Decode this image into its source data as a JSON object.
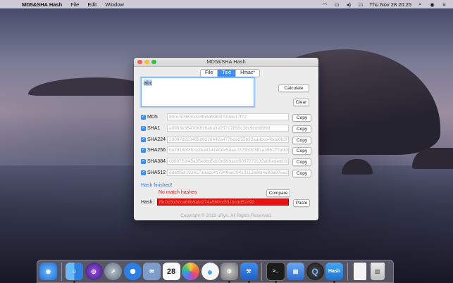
{
  "menubar": {
    "app_name": "MD5&SHA Hash",
    "menus": [
      "File",
      "Edit",
      "Window"
    ],
    "datetime": "Thu Nov 28  20:25",
    "icons": [
      "wifi-icon",
      "airplay-icon",
      "volume-icon",
      "battery-icon",
      "search-icon",
      "user-icon",
      "control-center-icon"
    ]
  },
  "window": {
    "title": "MD5&SHA Hash",
    "tabs": [
      {
        "label": "File",
        "active": false
      },
      {
        "label": "Text",
        "active": true
      },
      {
        "label": "Hmac*",
        "active": false
      }
    ],
    "input_text": "abc",
    "calculate_label": "Calculate",
    "clear_label": "Clear",
    "rows": [
      {
        "alg": "MD5",
        "hash": "900150983cd24fb0d6963f7d28e17f72",
        "copy": "Copy"
      },
      {
        "alg": "SHA1",
        "hash": "a9993e364706816aba3e25717850c26c9cd0d89d",
        "copy": "Copy"
      },
      {
        "alg": "SHA224",
        "hash": "23097d223405d8228642a477bda255b32aadbce4bda0b3f7e36c9da7",
        "copy": "Copy"
      },
      {
        "alg": "SHA256",
        "hash": "ba7816bf8f01cfea414140de5dae2223b00361a396177a9cb410ff61f20015ad",
        "copy": "Copy"
      },
      {
        "alg": "SHA384",
        "hash": "cb00753f45a35e8bb5a03d699ac65007272c32ab0eded1631a8b605a43ff5bed",
        "copy": "Copy"
      },
      {
        "alg": "SHA512",
        "hash": "ddaf35a193617abacc417349ae20413112e6fa4e89a97ea20a9eeee64b55d39a",
        "copy": "Copy"
      }
    ],
    "status": "Hash finished!",
    "match_status": "No match hashes",
    "compare_label": "Compare",
    "hash_label": "Hash:",
    "hash_value": "f8c0c5d3dca66b9afa274a560cc531bcdd52d92",
    "paste_label": "Paste",
    "copyright": "Copyright © 2018 uRyn. All Rights Reserved."
  },
  "dock": {
    "items": [
      {
        "name": "safari-icon",
        "color": "#2f8ef5",
        "glyph": "◉"
      },
      {
        "name": "finder-icon",
        "color": "#3d8ef7",
        "glyph": "☺"
      },
      {
        "name": "siri-icon",
        "color": "#3a2f7a",
        "glyph": "◎"
      },
      {
        "name": "launchpad-icon",
        "color": "#7f8a99",
        "glyph": "🚀"
      },
      {
        "name": "safari-browser-icon",
        "color": "#2d7fe8",
        "glyph": "✦"
      },
      {
        "name": "preview-icon",
        "color": "#6d8fbf",
        "glyph": "✉"
      },
      {
        "name": "calendar-icon",
        "color": "#f5f5f5",
        "glyph": "28"
      },
      {
        "name": "photos-icon",
        "color": "#f0d24a",
        "glyph": "✿"
      },
      {
        "name": "messages-icon",
        "color": "#3fa9f5",
        "glyph": "💬"
      },
      {
        "name": "system-preferences-icon",
        "color": "#8b8b8b",
        "glyph": "⚙"
      },
      {
        "name": "xcode-icon",
        "color": "#2e6fd6",
        "glyph": "⚒"
      },
      {
        "name": "terminal-icon",
        "color": "#1e1e1e",
        "glyph": ">_"
      },
      {
        "name": "keynote-icon",
        "color": "#4a8ee8",
        "glyph": "▤"
      },
      {
        "name": "quicktime-icon",
        "color": "#333",
        "glyph": "Q"
      },
      {
        "name": "hash-app-icon",
        "color": "#2c8ee6",
        "glyph": "Hash"
      },
      {
        "name": "document-icon",
        "color": "#f2f2f2",
        "glyph": ""
      },
      {
        "name": "trash-icon",
        "color": "#d9d9d9",
        "glyph": "🗑"
      }
    ]
  }
}
